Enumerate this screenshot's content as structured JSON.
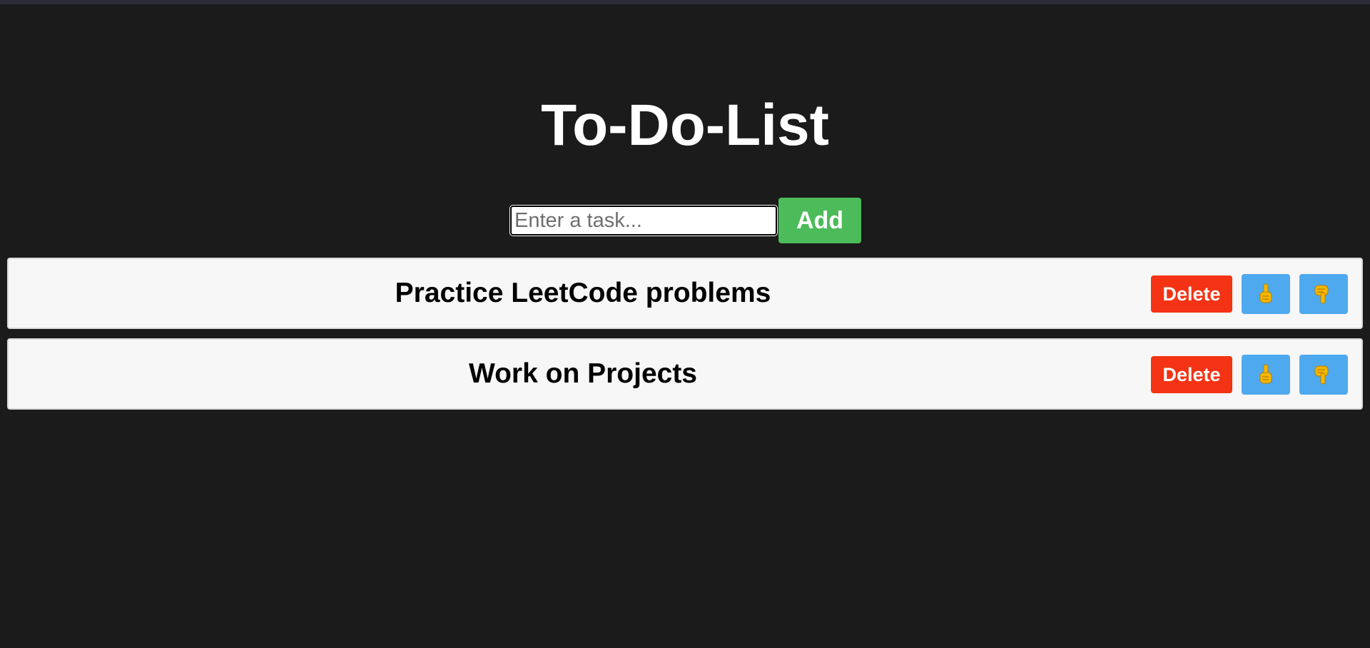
{
  "app": {
    "title": "To-Do-List"
  },
  "form": {
    "placeholder": "Enter a task...",
    "value": "",
    "add_label": "Add"
  },
  "tasks": [
    {
      "text": "Practice LeetCode problems",
      "delete_label": "Delete",
      "up_icon": "pointing-up-icon",
      "down_icon": "pointing-down-icon"
    },
    {
      "text": "Work on Projects",
      "delete_label": "Delete",
      "up_icon": "pointing-up-icon",
      "down_icon": "pointing-down-icon"
    }
  ],
  "colors": {
    "background": "#1b1b1b",
    "add_button": "#4cbb5a",
    "delete_button": "#f33314",
    "move_button": "#4fa9ee",
    "task_background": "#f7f7f7",
    "hand_icon": "#f5b800"
  }
}
